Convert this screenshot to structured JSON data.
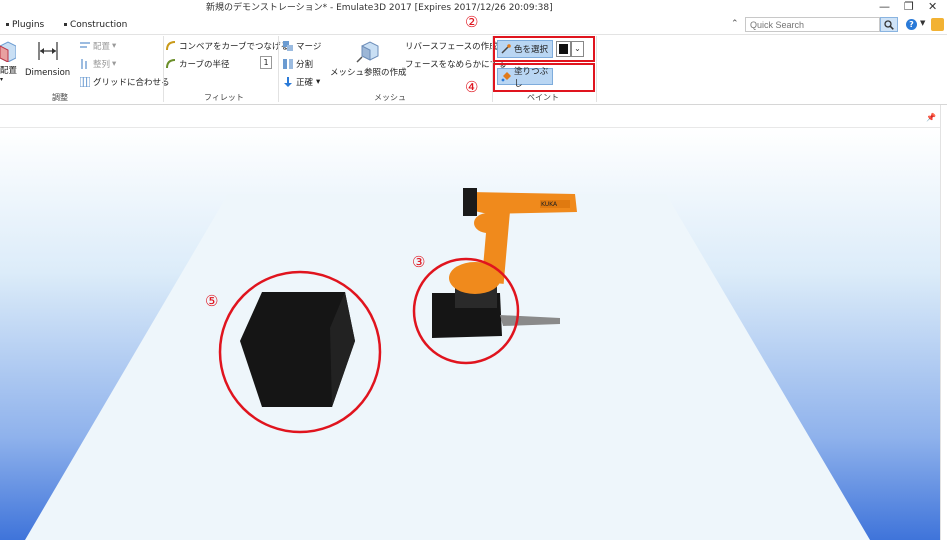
{
  "window": {
    "title": "新規のデモンストレーション* - Emulate3D 2017 [Expires 2017/12/26 20:09:38]"
  },
  "tabs": [
    {
      "label": "Plugins"
    },
    {
      "label": "Construction"
    }
  ],
  "search": {
    "placeholder": "Quick Search"
  },
  "ribbon": {
    "groups": {
      "adjust": {
        "label": "調整",
        "place": "配置",
        "dimension": "Dimension",
        "arrange": "配置",
        "align": "整列",
        "fit_grid": "グリッドに合わせる"
      },
      "fillet": {
        "label": "フィレット",
        "curve_conveyor": "コンベアをカーブでつなげる",
        "curve_radius": "カーブの半径",
        "radius_value": "1"
      },
      "mesh": {
        "label": "メッシュ",
        "merge": "マージ",
        "split": "分割",
        "normal": "正確",
        "mesh_ref": "メッシュ参照の作成",
        "reverse_face": "リバースフェースの作成",
        "smooth_face": "フェースをなめらかにする"
      },
      "paint": {
        "label": "ペイント",
        "pick_color": "色を選択",
        "fill": "塗りつぶし",
        "swatch_color": "#111111"
      }
    }
  },
  "annotations": {
    "n2": "②",
    "n3": "③",
    "n4": "④",
    "n5": "⑤"
  },
  "colors": {
    "annotation": "#e0141e",
    "floor": "#eef6fb",
    "sky_top": "#ffffff",
    "sky_bottom": "#3f74da",
    "robot": "#f08a1c",
    "cube": "#151515"
  }
}
